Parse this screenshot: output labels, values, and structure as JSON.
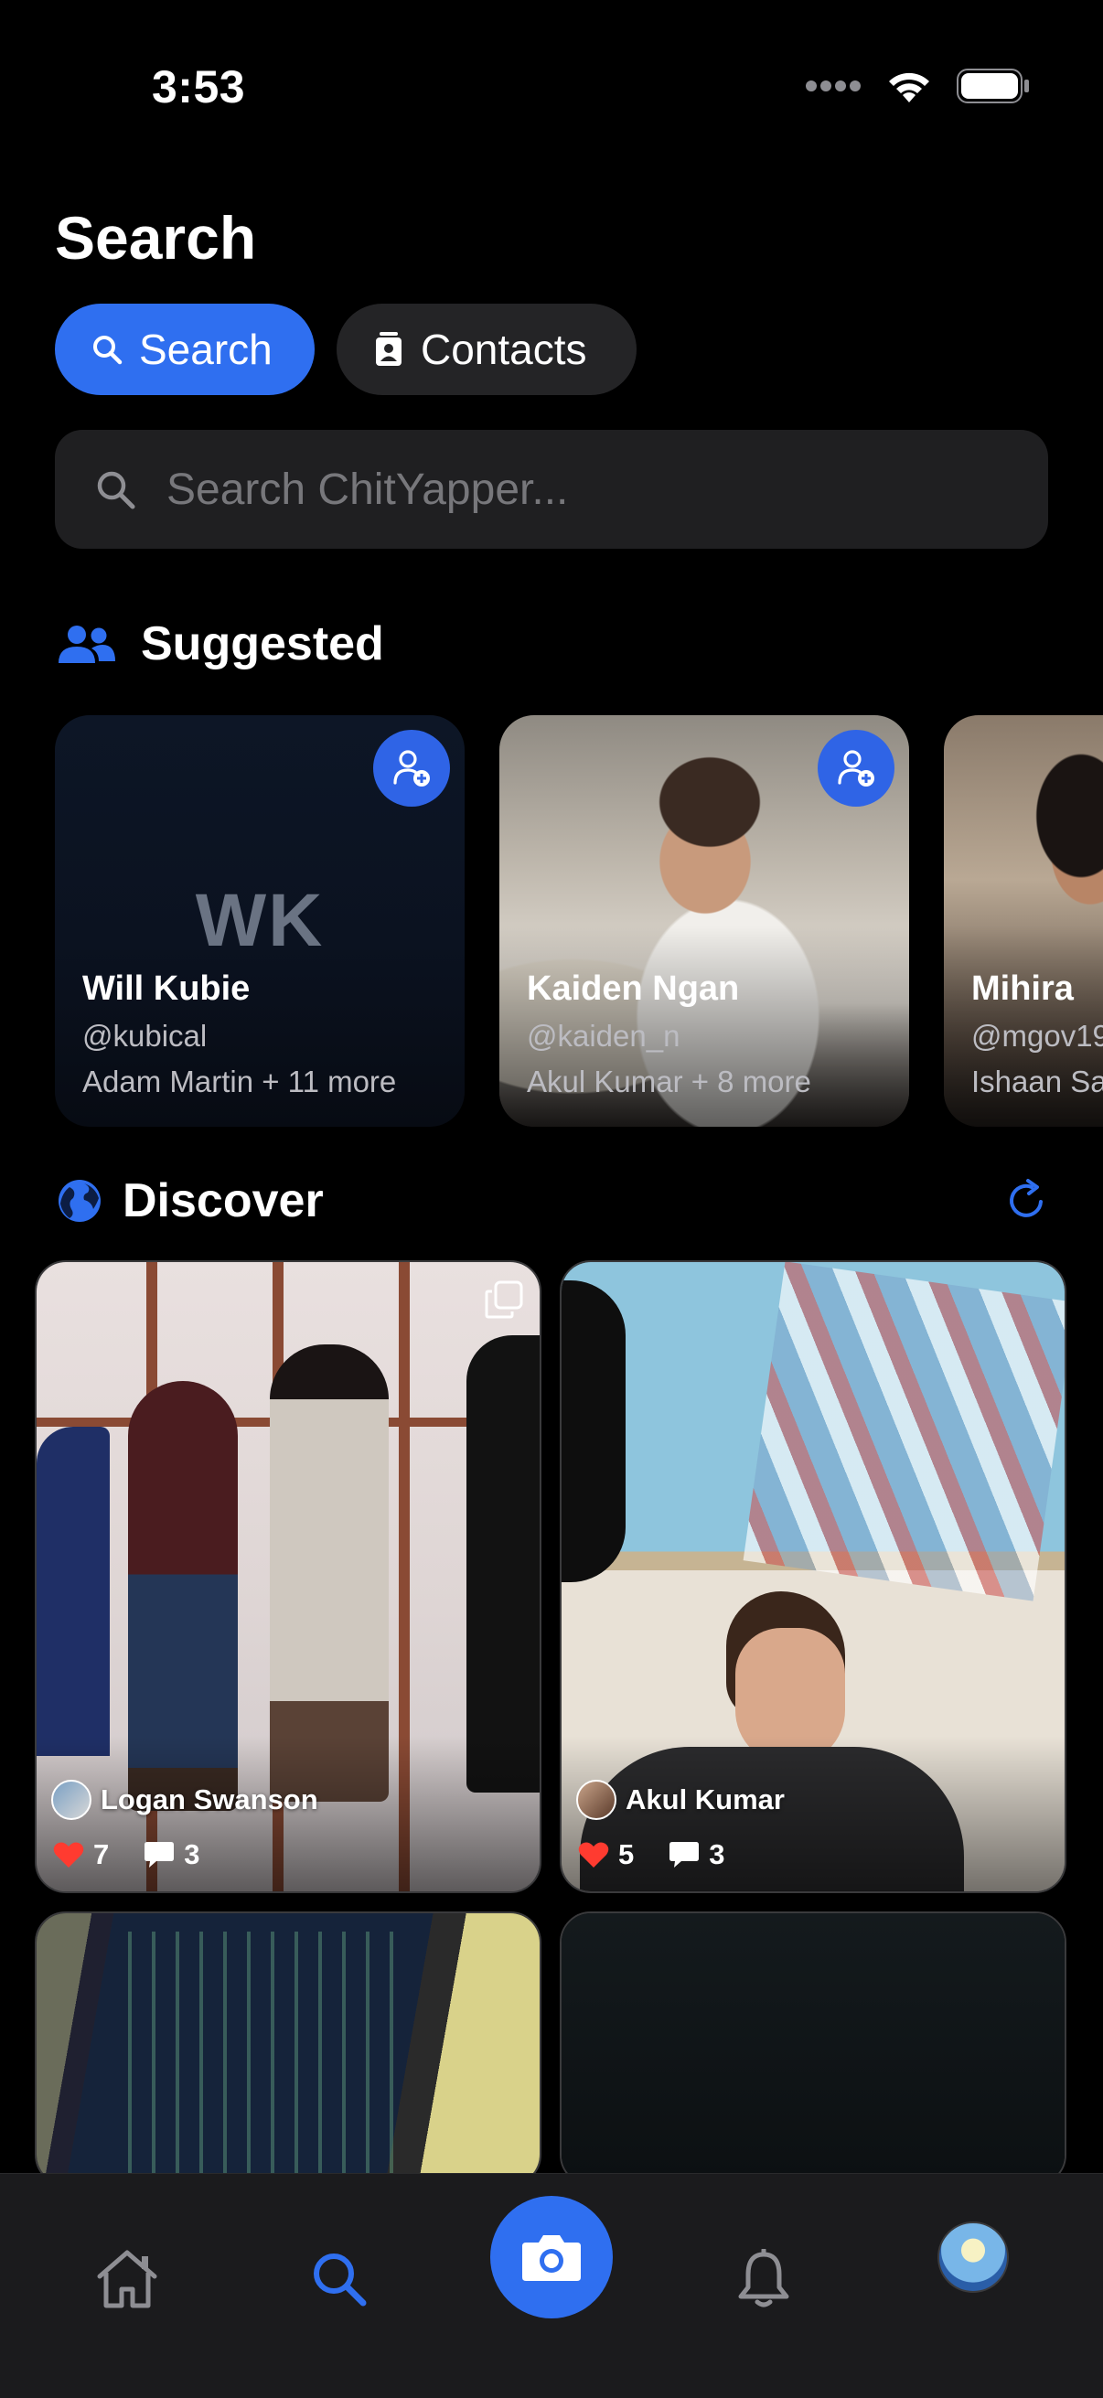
{
  "status_bar": {
    "time": "3:53"
  },
  "page": {
    "title": "Search"
  },
  "segments": {
    "search_label": "Search",
    "contacts_label": "Contacts",
    "active": "Search"
  },
  "search": {
    "placeholder": "Search ChitYapper...",
    "value": ""
  },
  "suggested": {
    "header": "Suggested",
    "users": [
      {
        "initials": "WK",
        "name": "Will Kubie",
        "handle": "@kubical",
        "mutual": "Adam Martin + 11 more"
      },
      {
        "name": "Kaiden Ngan",
        "handle": "@kaiden_n",
        "mutual": "Akul Kumar + 8 more"
      },
      {
        "name": "Mihira",
        "handle": "@mgov19",
        "mutual": "Ishaan Sa"
      }
    ]
  },
  "discover": {
    "header": "Discover",
    "posts": [
      {
        "author": "Logan Swanson",
        "likes": "7",
        "comments": "3"
      },
      {
        "author": "Akul Kumar",
        "likes": "5",
        "comments": "3"
      }
    ]
  },
  "colors": {
    "accent": "#2f6ff0",
    "background": "#000000",
    "like": "#ff3b30"
  },
  "tabbar": {
    "icons": [
      "home-icon",
      "search-icon",
      "camera-icon",
      "bell-icon",
      "profile-avatar"
    ],
    "active": "search-icon"
  }
}
